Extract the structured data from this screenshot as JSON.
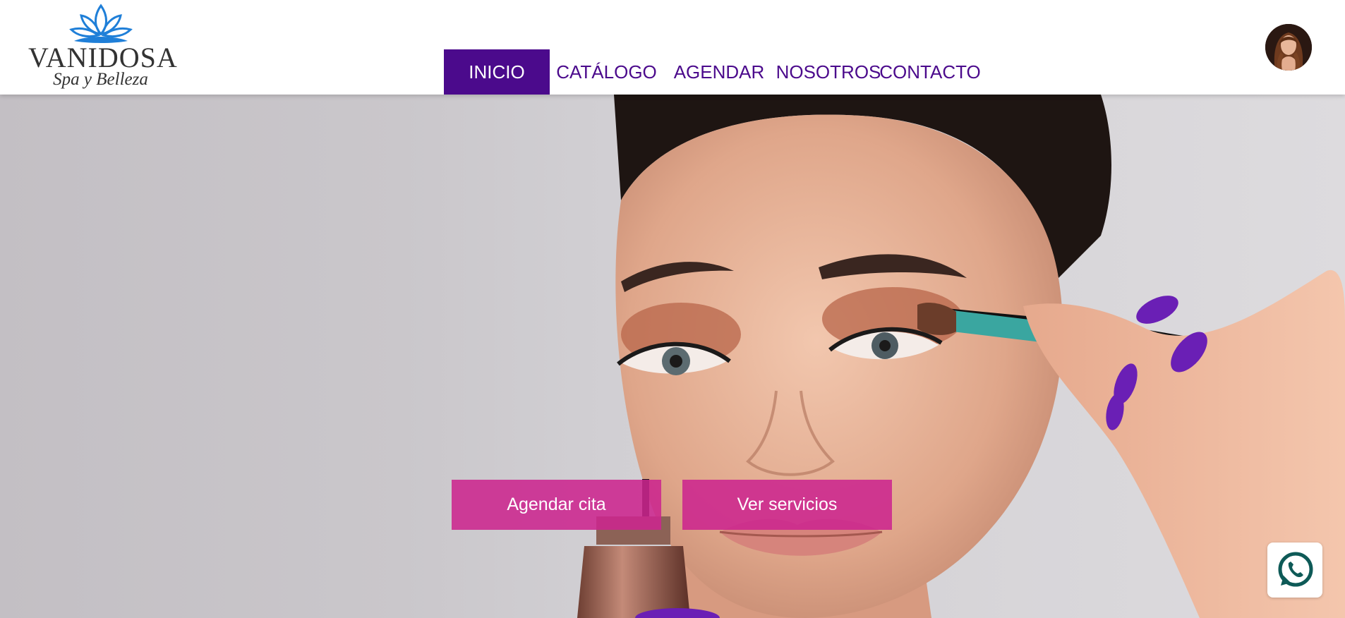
{
  "header": {
    "logo": {
      "brand": "VANIDOSA",
      "tagline": "Spa y Belleza",
      "icon": "lotus-icon",
      "color": "#1f7fd8"
    },
    "nav": [
      {
        "label": "INICIO",
        "active": true
      },
      {
        "label": "CATÁLOGO",
        "active": false
      },
      {
        "label": "AGENDAR",
        "active": false
      },
      {
        "label": "NOSOTROS",
        "active": false
      },
      {
        "label": "CONTACTO",
        "active": false
      }
    ],
    "avatar": {
      "icon": "user-avatar-icon"
    }
  },
  "hero": {
    "image": "makeup-model-photo",
    "buttons": [
      {
        "label": "Agendar cita"
      },
      {
        "label": "Ver servicios"
      }
    ]
  },
  "whatsapp": {
    "icon": "whatsapp-icon"
  },
  "colors": {
    "primary": "#4b0a8c",
    "accent": "#cc268e",
    "logo_blue": "#1f7fd8",
    "nail_purple": "#6a1fb5"
  }
}
